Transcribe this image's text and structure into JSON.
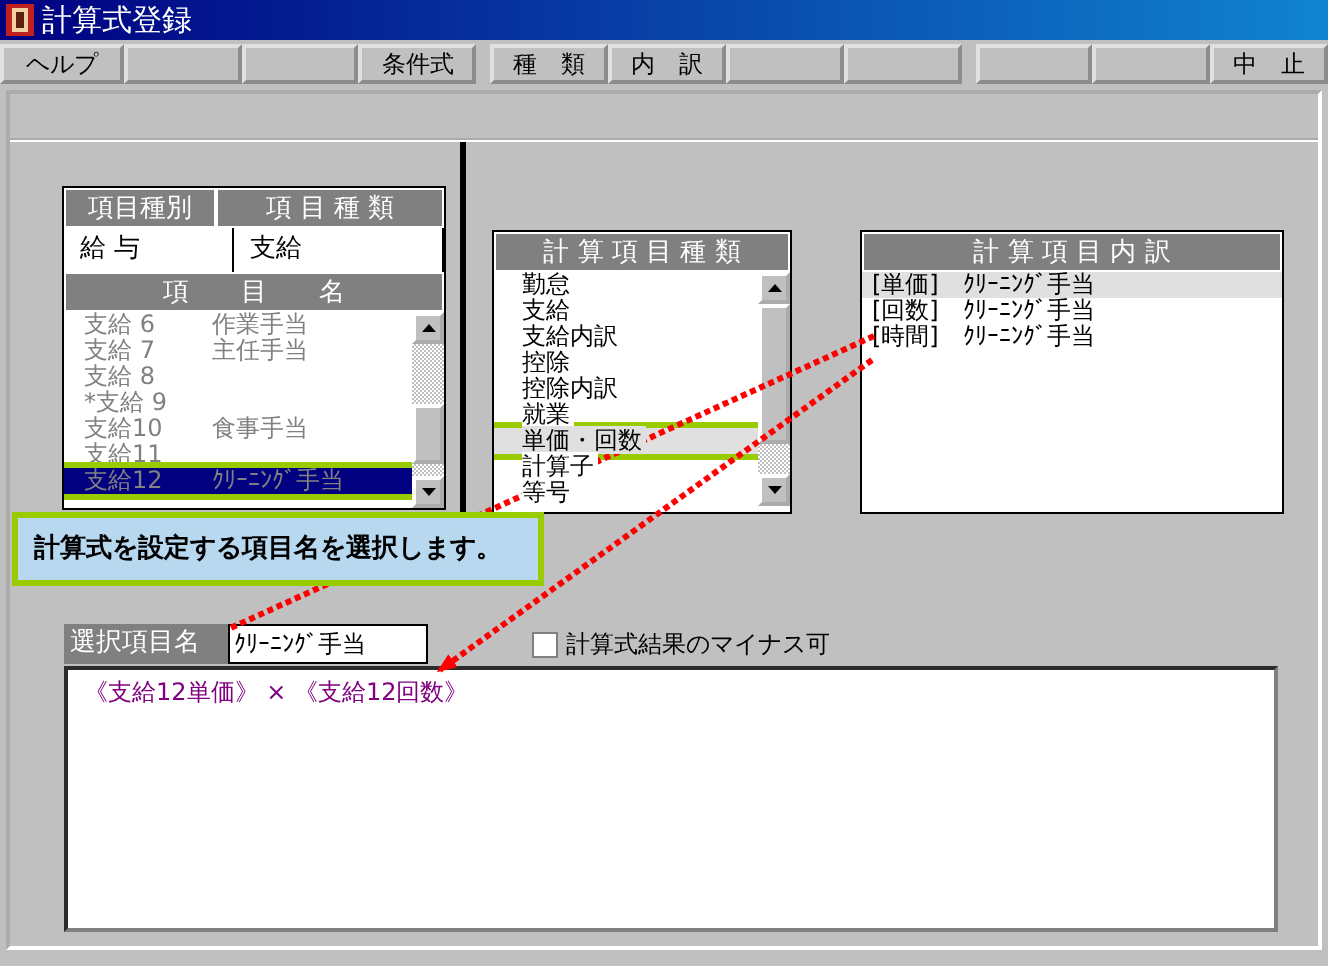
{
  "window": {
    "title": "計算式登録"
  },
  "toolbar": [
    {
      "kind": "button",
      "label": "ヘルプ"
    },
    {
      "kind": "blank"
    },
    {
      "kind": "blank"
    },
    {
      "kind": "button",
      "label": "条件式"
    },
    {
      "kind": "gap"
    },
    {
      "kind": "button",
      "label": "種　類"
    },
    {
      "kind": "button",
      "label": "内　訳"
    },
    {
      "kind": "blank"
    },
    {
      "kind": "blank"
    },
    {
      "kind": "gap"
    },
    {
      "kind": "blank"
    },
    {
      "kind": "blank"
    },
    {
      "kind": "button",
      "label": "中　止"
    }
  ],
  "item_table": {
    "columns": [
      "項目種別",
      "項 目 種 類"
    ],
    "values": [
      "給 与",
      "支給"
    ],
    "list_header": "項　　目　　名",
    "rows": [
      {
        "code": "支給 6",
        "name": "作業手当",
        "selected": false,
        "annotated": false
      },
      {
        "code": "支給 7",
        "name": "主任手当",
        "selected": false,
        "annotated": false
      },
      {
        "code": "支給 8",
        "name": "",
        "selected": false,
        "annotated": false
      },
      {
        "code": "*支給 9",
        "name": "",
        "selected": false,
        "annotated": false
      },
      {
        "code": "支給10",
        "name": "食事手当",
        "selected": false,
        "annotated": false
      },
      {
        "code": "支給11",
        "name": "",
        "selected": false,
        "annotated": false
      },
      {
        "code": "支給12",
        "name": "ｸﾘｰﾆﾝｸﾞ手当",
        "selected": true,
        "annotated": true
      }
    ]
  },
  "calc_types": {
    "header": "計 算 項 目 種 類",
    "items": [
      {
        "label": "勤怠",
        "selected": false,
        "annotated": false
      },
      {
        "label": "支給",
        "selected": false,
        "annotated": false
      },
      {
        "label": "支給内訳",
        "selected": false,
        "annotated": false
      },
      {
        "label": "控除",
        "selected": false,
        "annotated": false
      },
      {
        "label": "控除内訳",
        "selected": false,
        "annotated": false
      },
      {
        "label": "就業",
        "selected": false,
        "annotated": false
      },
      {
        "label": "単価・回数",
        "selected": true,
        "annotated": true
      },
      {
        "label": "計算子",
        "selected": false,
        "annotated": false
      },
      {
        "label": "等号",
        "selected": false,
        "annotated": false
      }
    ]
  },
  "calc_details": {
    "header": "計 算 項 目 内 訳",
    "items": [
      {
        "label": "[単価]　ｸﾘｰﾆﾝｸﾞ手当",
        "selected": true
      },
      {
        "label": "[回数]　ｸﾘｰﾆﾝｸﾞ手当",
        "selected": false
      },
      {
        "label": "[時間]　ｸﾘｰﾆﾝｸﾞ手当",
        "selected": false
      }
    ]
  },
  "selected_item": {
    "label": "選択項目名",
    "value": "ｸﾘｰﾆﾝｸﾞ手当"
  },
  "allow_negative": {
    "label": "計算式結果のマイナス可",
    "checked": false
  },
  "formula": "《支給12単価》 × 《支給12回数》",
  "callout": "計算式を設定する項目名を選択します。"
}
